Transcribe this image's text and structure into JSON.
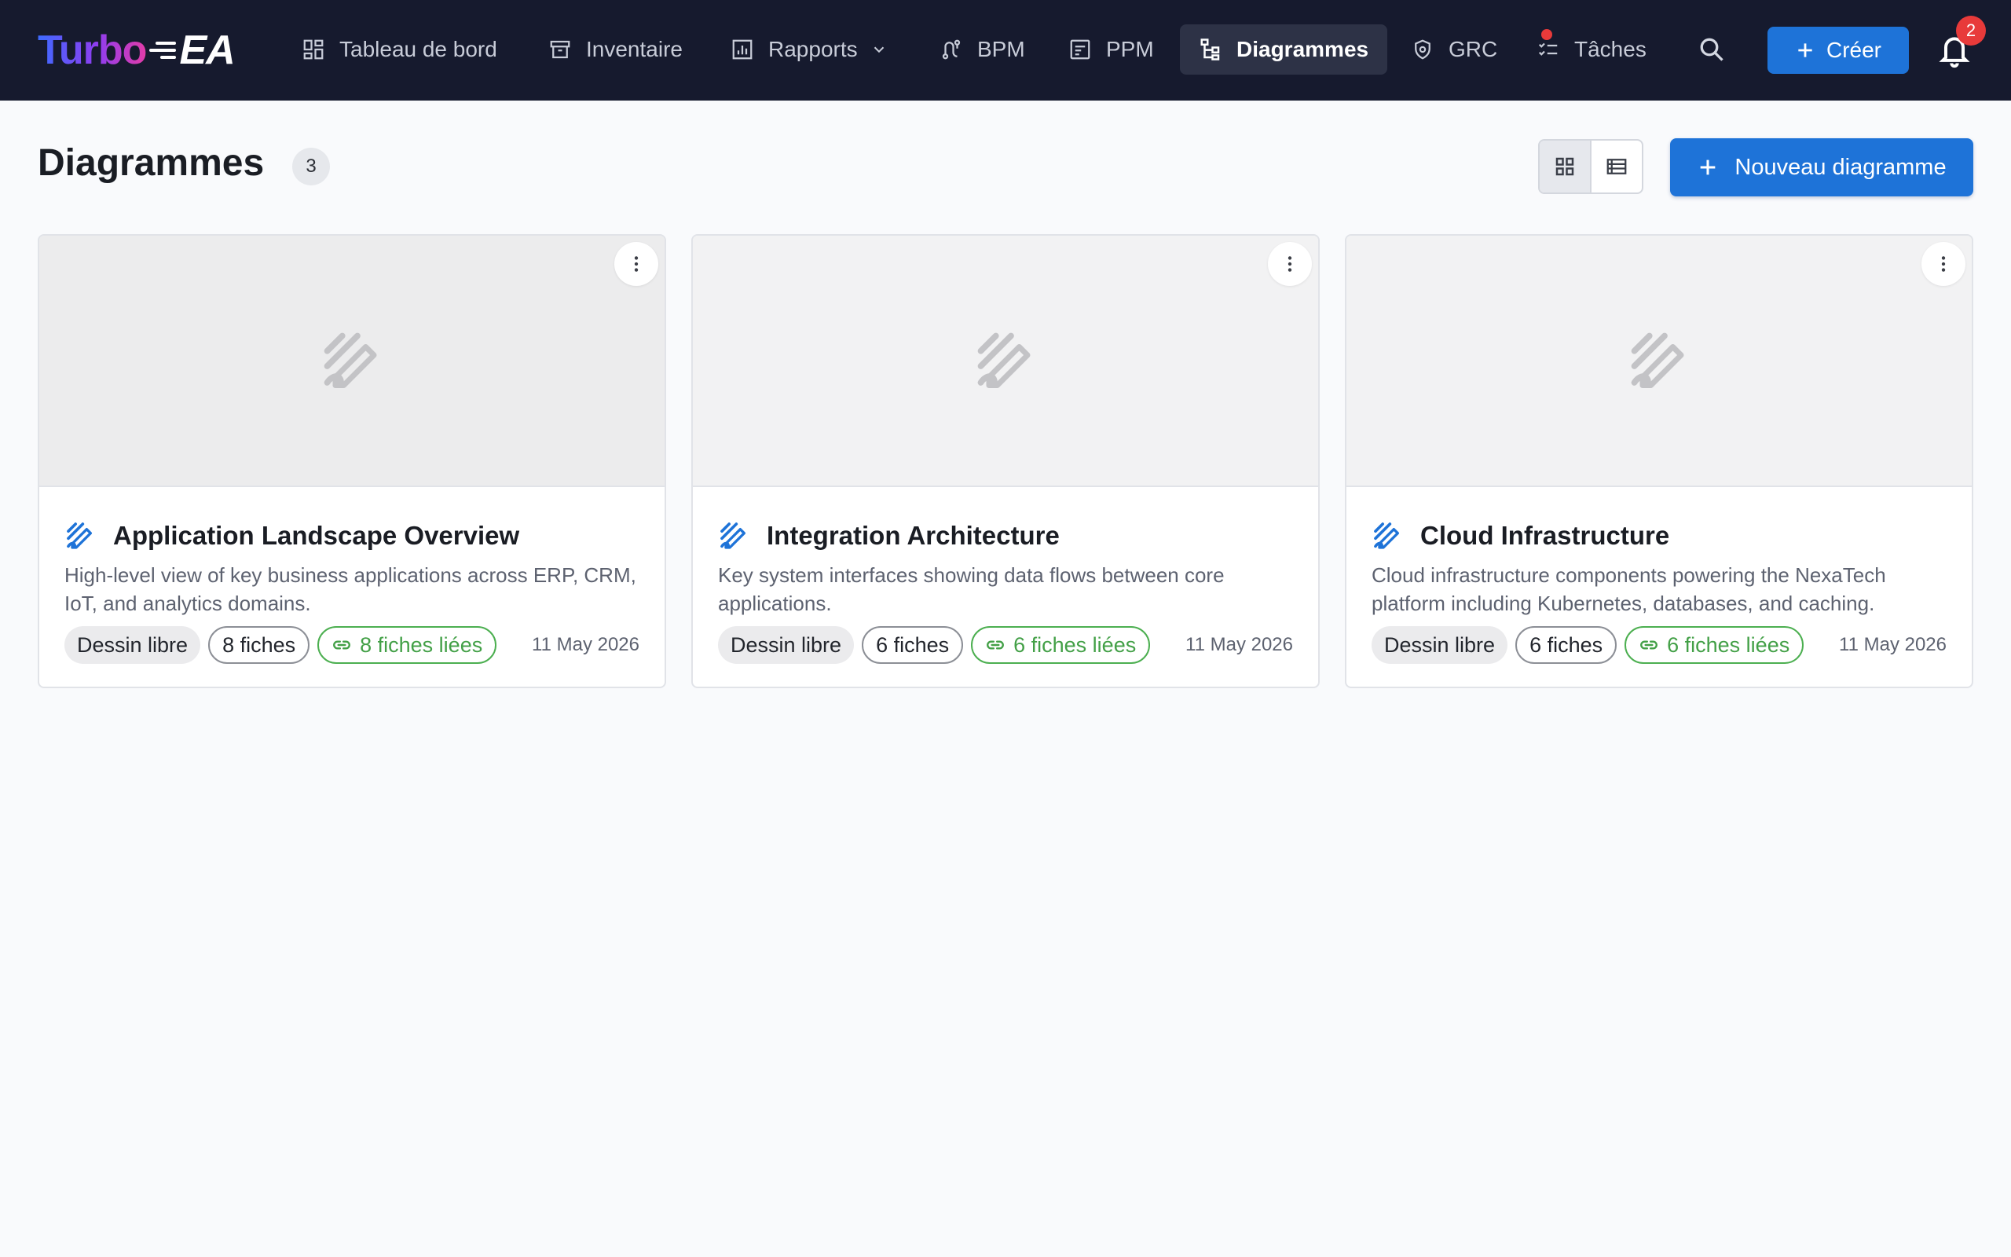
{
  "app": {
    "logo_main": "Turbo",
    "logo_suffix": "EA"
  },
  "nav": {
    "items": [
      {
        "label": "Tableau de bord",
        "icon": "dashboard-icon"
      },
      {
        "label": "Inventaire",
        "icon": "archive-icon"
      },
      {
        "label": "Rapports",
        "icon": "report-chart-icon"
      },
      {
        "label": "BPM",
        "icon": "process-route-icon"
      },
      {
        "label": "PPM",
        "icon": "project-icon"
      },
      {
        "label": "Diagrammes",
        "icon": "diagram-tree-icon"
      },
      {
        "label": "GRC",
        "icon": "shield-icon"
      },
      {
        "label": "Tâches",
        "icon": "checklist-icon"
      }
    ],
    "active": "Diagrammes",
    "create_label": "Créer",
    "notification_count": "2"
  },
  "page": {
    "title": "Diagrammes",
    "count": "3",
    "new_button_label": "Nouveau diagramme",
    "view_mode": "grid"
  },
  "colors": {
    "topbar": "#161a2e",
    "primary": "#1e73d8",
    "linked_green": "#43a047",
    "badge_red": "#e83a3a"
  },
  "diagrams": [
    {
      "title": "Application Landscape Overview",
      "description": "High-level view of key business applications across ERP, CRM, IoT, and analytics domains.",
      "type": "Dessin libre",
      "cards": "8 fiches",
      "linked": "8 fiches liées",
      "date": "11 May 2026"
    },
    {
      "title": "Integration Architecture",
      "description": "Key system interfaces showing data flows between core applications.",
      "type": "Dessin libre",
      "cards": "6 fiches",
      "linked": "6 fiches liées",
      "date": "11 May 2026"
    },
    {
      "title": "Cloud Infrastructure",
      "description": "Cloud infrastructure components powering the NexaTech platform including Kubernetes, databases, and caching.",
      "type": "Dessin libre",
      "cards": "6 fiches",
      "linked": "6 fiches liées",
      "date": "11 May 2026"
    }
  ]
}
